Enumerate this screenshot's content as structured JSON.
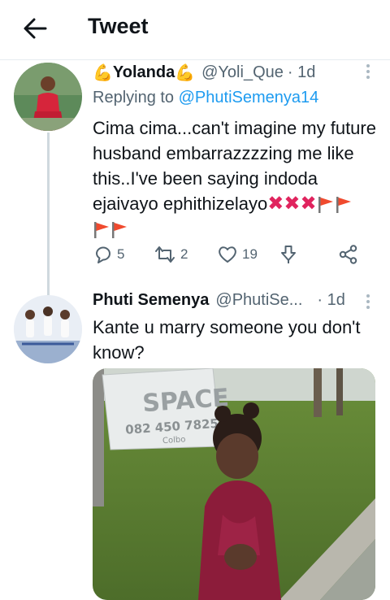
{
  "header": {
    "title": "Tweet"
  },
  "tweet1": {
    "name": "Yolanda",
    "handle": "@Yoli_Que",
    "time": "· 1d",
    "reply_prefix": "Replying to ",
    "reply_handle": "@PhutiSemenya14",
    "text_lines": [
      "Cima cima...can't imagine my future",
      "husband embarrazzzzing me like",
      "this..I've been saying indoda",
      "ejaivayo ephithizelayo"
    ],
    "emoji": {
      "cross": "✖",
      "flag": "🚩"
    },
    "replies": "5",
    "retweets": "2",
    "likes": "19"
  },
  "tweet2": {
    "name": "Phuti Semenya",
    "handle": "@PhutiSe...",
    "time": "· 1d",
    "text_lines": [
      "Kante u marry someone you don't",
      "know?"
    ],
    "image": {
      "sign_text": "SPACE",
      "sign_phone": "082 450 7825",
      "sign_sub": "Colbo"
    }
  },
  "icons": {
    "back": "arrow-left-icon",
    "reply": "comment-icon",
    "retweet": "retweet-icon",
    "like": "heart-icon",
    "download": "download-icon",
    "share": "share-icon",
    "more": "more-vertical-icon"
  },
  "colors": {
    "link": "#1d9bf0",
    "muted": "#536471",
    "cross": "#e0245e",
    "flag": "#f04a2e"
  }
}
